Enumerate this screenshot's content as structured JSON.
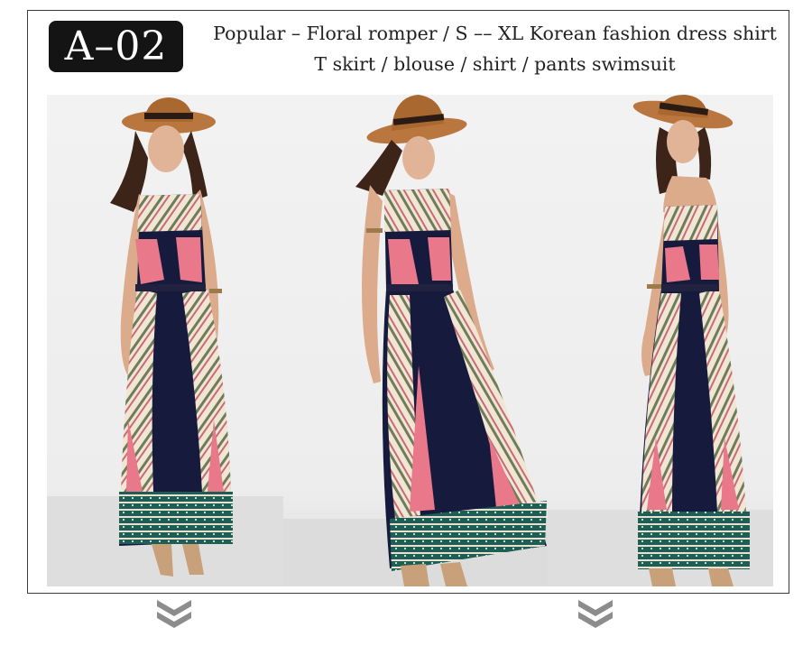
{
  "badge": {
    "code": "A–02"
  },
  "headline": {
    "line1": "Popular – Floral romper / S –– XL Korean fashion dress shirt",
    "line2": "T skirt / blouse / shirt / pants swimsuit"
  },
  "photos": [
    {
      "view": "front"
    },
    {
      "view": "walking-side"
    },
    {
      "view": "back"
    }
  ],
  "colors": {
    "frame": "#3a3a3a",
    "badge_bg": "#141414",
    "hat": "#b9773f",
    "dress_navy": "#161a3c",
    "dress_pink": "#e9788a",
    "dress_green": "#2f7a66",
    "chevron": "#8c8c8c"
  },
  "icons": [
    "double-chevron-down-icon",
    "double-chevron-down-icon"
  ]
}
